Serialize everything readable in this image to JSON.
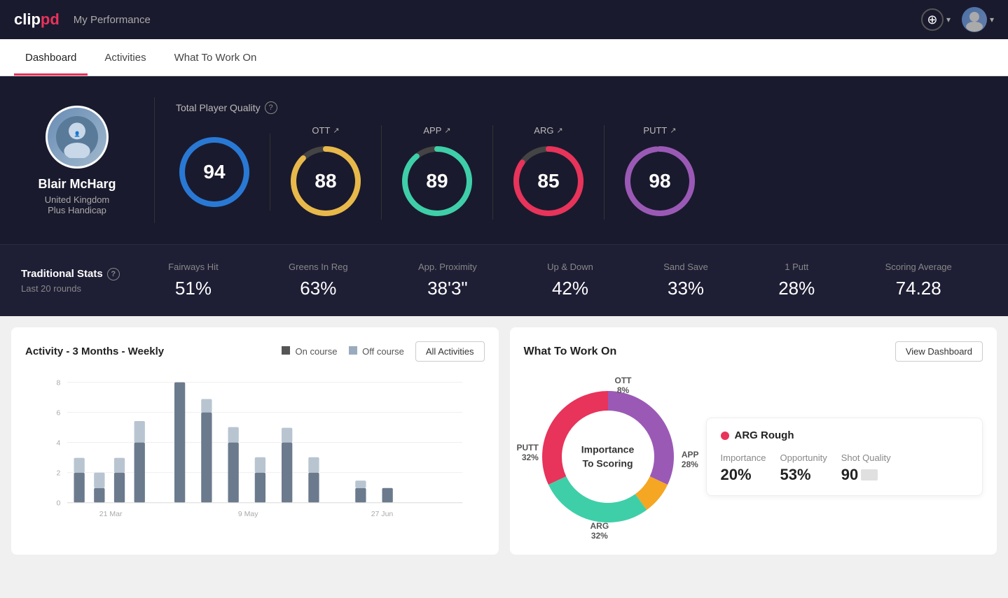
{
  "header": {
    "logo_clip": "clip",
    "logo_pd": "pd",
    "title": "My Performance",
    "add_label": "+",
    "chevron": "▾"
  },
  "nav": {
    "tabs": [
      {
        "label": "Dashboard",
        "active": true
      },
      {
        "label": "Activities",
        "active": false
      },
      {
        "label": "What To Work On",
        "active": false
      }
    ]
  },
  "hero": {
    "total_quality_label": "Total Player Quality",
    "profile": {
      "name": "Blair McHarg",
      "country": "United Kingdom",
      "handicap": "Plus Handicap"
    },
    "scores": [
      {
        "label": "94",
        "category": "",
        "color": "#2979d4",
        "trail": "#1a4a8a",
        "value": 94
      },
      {
        "label": "88",
        "category": "OTT",
        "color": "#e8b94a",
        "trail": "#555",
        "value": 88
      },
      {
        "label": "89",
        "category": "APP",
        "color": "#3ecfa8",
        "trail": "#555",
        "value": 89
      },
      {
        "label": "85",
        "category": "ARG",
        "color": "#e8335a",
        "trail": "#555",
        "value": 85
      },
      {
        "label": "98",
        "category": "PUTT",
        "color": "#9b59b6",
        "trail": "#555",
        "value": 98
      }
    ]
  },
  "stats": {
    "title": "Traditional Stats",
    "subtitle": "Last 20 rounds",
    "items": [
      {
        "label": "Fairways Hit",
        "value": "51%"
      },
      {
        "label": "Greens In Reg",
        "value": "63%"
      },
      {
        "label": "App. Proximity",
        "value": "38'3\""
      },
      {
        "label": "Up & Down",
        "value": "42%"
      },
      {
        "label": "Sand Save",
        "value": "33%"
      },
      {
        "label": "1 Putt",
        "value": "28%"
      },
      {
        "label": "Scoring Average",
        "value": "74.28"
      }
    ]
  },
  "activity_chart": {
    "title": "Activity - 3 Months - Weekly",
    "legend": {
      "on_course": "On course",
      "off_course": "Off course"
    },
    "all_activities_btn": "All Activities",
    "x_labels": [
      "21 Mar",
      "9 May",
      "27 Jun"
    ],
    "y_labels": [
      "0",
      "2",
      "4",
      "6",
      "8"
    ]
  },
  "what_to_work_on": {
    "title": "What To Work On",
    "view_dashboard_btn": "View Dashboard",
    "donut_label": "Importance\nTo Scoring",
    "segments": [
      {
        "label": "OTT",
        "value": "8%",
        "color": "#f5a623"
      },
      {
        "label": "APP",
        "value": "28%",
        "color": "#3ecfa8"
      },
      {
        "label": "ARG",
        "value": "32%",
        "color": "#e8335a"
      },
      {
        "label": "PUTT",
        "value": "32%",
        "color": "#9b59b6"
      }
    ],
    "card": {
      "title": "ARG Rough",
      "dot_color": "#e8335a",
      "metrics": [
        {
          "label": "Importance",
          "value": "20%"
        },
        {
          "label": "Opportunity",
          "value": "53%"
        },
        {
          "label": "Shot Quality",
          "value": "90"
        }
      ]
    }
  }
}
